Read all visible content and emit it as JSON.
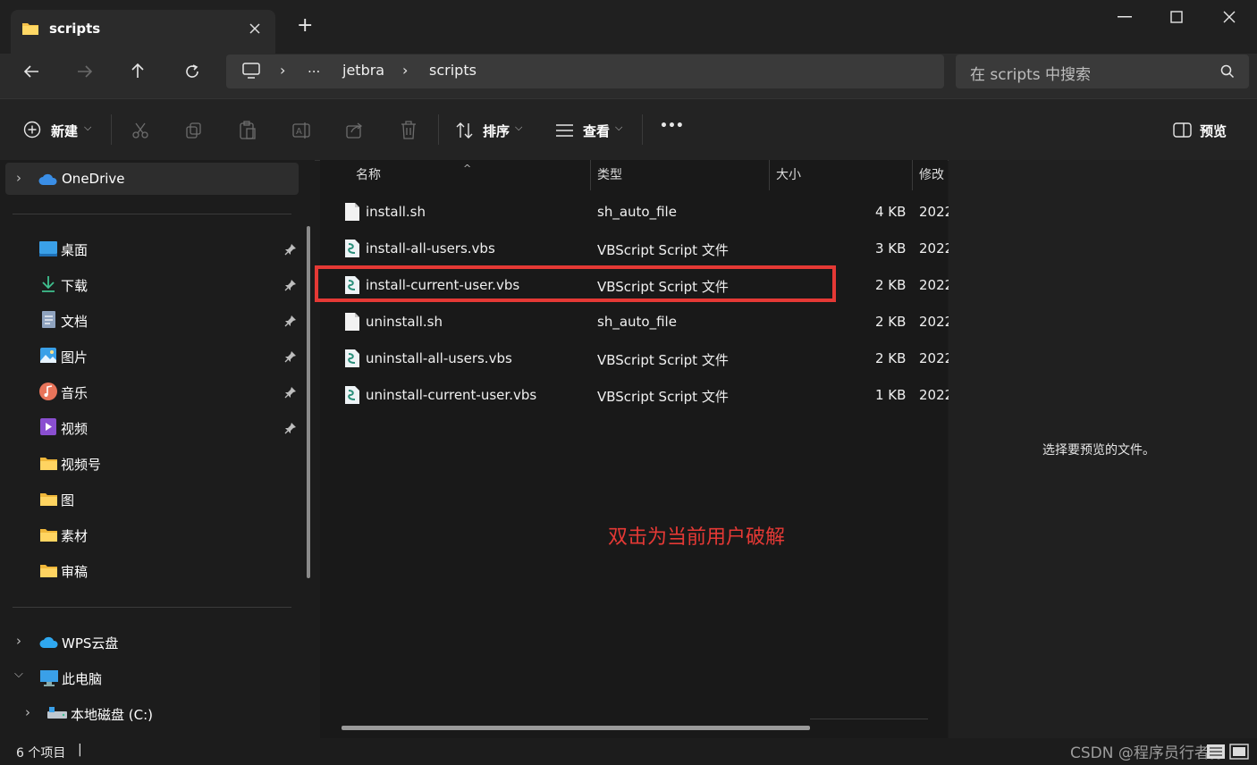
{
  "window": {
    "tab_title": "scripts",
    "new_tab_label": "+",
    "icons": [
      "folder-icon",
      "close-icon",
      "minimize-icon",
      "maximize-icon",
      "window-close-icon"
    ]
  },
  "nav": {
    "breadcrumb": [
      "...",
      "jetbra",
      "scripts"
    ],
    "search_placeholder": "在 scripts 中搜索"
  },
  "toolbar": {
    "new_label": "新建",
    "sort_label": "排序",
    "view_label": "查看",
    "more_label": "•••",
    "preview_label": "预览"
  },
  "sidebar": {
    "onedrive": "OneDrive",
    "quick_access": [
      {
        "label": "桌面",
        "icon": "desktop-icon",
        "pinned": true
      },
      {
        "label": "下载",
        "icon": "download-icon",
        "pinned": true
      },
      {
        "label": "文档",
        "icon": "document-icon",
        "pinned": true
      },
      {
        "label": "图片",
        "icon": "pictures-icon",
        "pinned": true
      },
      {
        "label": "音乐",
        "icon": "music-icon",
        "pinned": true
      },
      {
        "label": "视频",
        "icon": "video-icon",
        "pinned": true
      },
      {
        "label": "视频号",
        "icon": "folder-icon",
        "pinned": false
      },
      {
        "label": "图",
        "icon": "folder-icon",
        "pinned": false
      },
      {
        "label": "素材",
        "icon": "folder-icon",
        "pinned": false
      },
      {
        "label": "审稿",
        "icon": "folder-icon",
        "pinned": false
      }
    ],
    "wps_cloud": "WPS云盘",
    "this_pc": "此电脑",
    "local_disk": "本地磁盘 (C:)"
  },
  "files": {
    "columns": [
      "名称",
      "类型",
      "大小",
      "修改"
    ],
    "rows": [
      {
        "name": "install.sh",
        "type": "sh_auto_file",
        "size": "4 KB",
        "modified": "2022",
        "icon": "generic-file-icon"
      },
      {
        "name": "install-all-users.vbs",
        "type": "VBScript Script 文件",
        "size": "3 KB",
        "modified": "2022",
        "icon": "vbs-file-icon"
      },
      {
        "name": "install-current-user.vbs",
        "type": "VBScript Script 文件",
        "size": "2 KB",
        "modified": "2022",
        "icon": "vbs-file-icon"
      },
      {
        "name": "uninstall.sh",
        "type": "sh_auto_file",
        "size": "2 KB",
        "modified": "2022",
        "icon": "generic-file-icon"
      },
      {
        "name": "uninstall-all-users.vbs",
        "type": "VBScript Script 文件",
        "size": "2 KB",
        "modified": "2022",
        "icon": "vbs-file-icon"
      },
      {
        "name": "uninstall-current-user.vbs",
        "type": "VBScript Script 文件",
        "size": "1 KB",
        "modified": "2022",
        "icon": "vbs-file-icon"
      }
    ]
  },
  "annotation": {
    "text": "双击为当前用户破解",
    "color": "#e53935",
    "highlight_color": "#e53935"
  },
  "preview": {
    "empty_text": "选择要预览的文件。"
  },
  "status": {
    "item_count": "6 个项目",
    "cursor": "|"
  },
  "watermark": "CSDN @程序员行者孙"
}
